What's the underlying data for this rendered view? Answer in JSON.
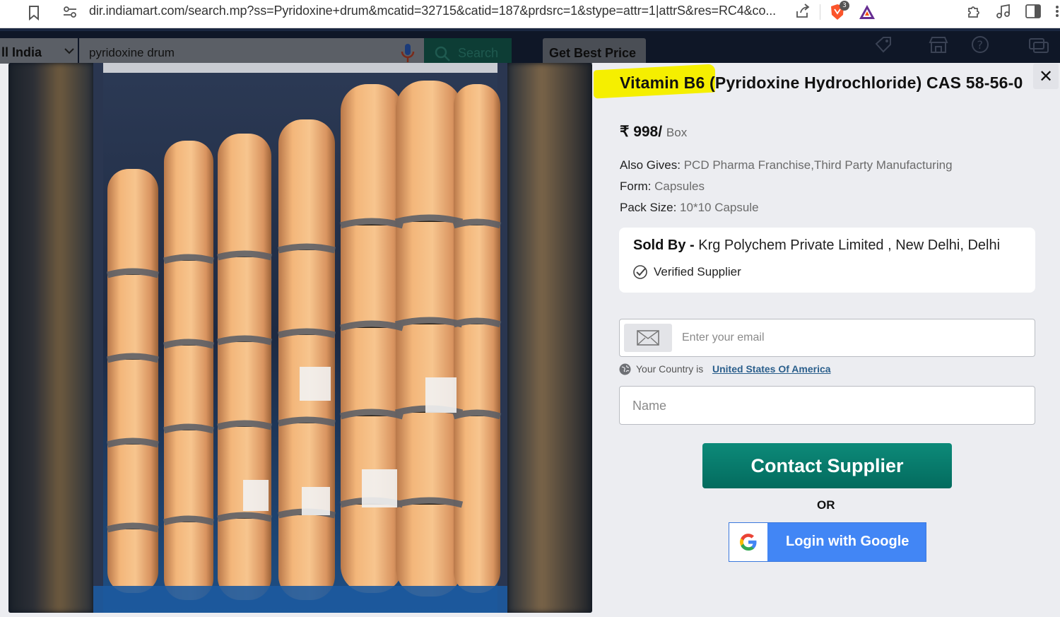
{
  "browser": {
    "url": "dir.indiamart.com/search.mp?ss=Pyridoxine+drum&mcatid=32715&catid=187&prdsrc=1&stype=attr=1|attrS&res=RC4&co...",
    "brave_badge": "3"
  },
  "site_header": {
    "location": "ll India",
    "search_query": "pyridoxine drum",
    "search_button": "Search",
    "get_best_price": "Get Best Price"
  },
  "product": {
    "title": "Vitamin B6 (Pyridoxine Hydrochloride) CAS 58-56-0",
    "highlighted_text": "Vitamin B6",
    "price": "₹ 998/",
    "price_unit": "Box",
    "specs": [
      {
        "label": "Also Gives:",
        "value": "PCD Pharma Franchise,Third Party Manufacturing"
      },
      {
        "label": "Form:",
        "value": "Capsules"
      },
      {
        "label": "Pack Size:",
        "value": "10*10 Capsule"
      }
    ]
  },
  "seller": {
    "sold_by_label": "Sold By -",
    "name": "Krg Polychem Private Limited , New Delhi, Delhi",
    "verified_label": "Verified Supplier"
  },
  "form": {
    "email_placeholder": "Enter your email",
    "country_prefix": "Your Country is",
    "country": "United States Of America",
    "name_placeholder": "Name",
    "contact_button": "Contact Supplier",
    "or_label": "OR",
    "google_button": "Login with Google"
  },
  "colors": {
    "contact_green": "#0a7f70",
    "google_blue": "#4286f5",
    "highlight_yellow": "#f5ef00",
    "link_blue": "#2b5f8c"
  }
}
